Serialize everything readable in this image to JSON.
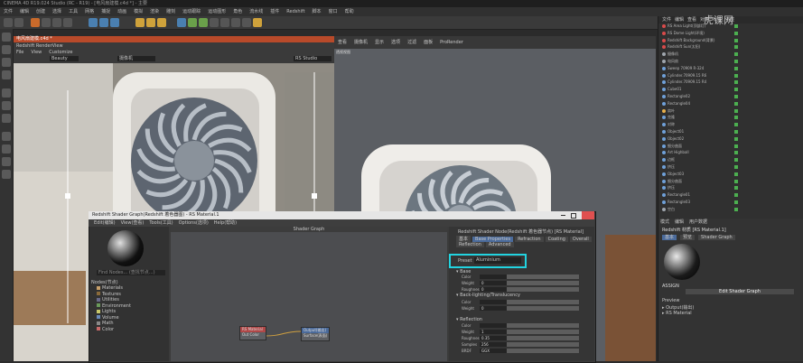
{
  "app": {
    "title": "CINEMA 4D R19.024 Studio (RC - R19) - [电风扇建模.c4d *] - 主要",
    "menu": [
      "文件",
      "编辑",
      "创建",
      "选择",
      "工具",
      "网格",
      "捕捉",
      "动画",
      "模拟",
      "渲染",
      "雕刻",
      "运动跟踪",
      "运动图形",
      "角色",
      "流水线",
      "插件",
      "Redshift",
      "脚本",
      "窗口",
      "帮助"
    ]
  },
  "watermark": "虎课网",
  "left_viewport": {
    "tabs": [
      "File",
      "View",
      "Customize"
    ],
    "title_tab": "电风扇建模.c4d *",
    "panel_title": "Redshift RenderView",
    "beauty_label": "Beauty",
    "toolbar_label": "摄像机",
    "aov_label": "RS Studio"
  },
  "right_viewport": {
    "menu": [
      "查看",
      "摄像机",
      "显示",
      "选项",
      "过滤",
      "面板",
      "ProRender"
    ],
    "label": "透视视图"
  },
  "scene_tree": {
    "header": [
      "文件",
      "编辑",
      "查看",
      "对象",
      "标签",
      "书签"
    ],
    "items": [
      {
        "label": "RS Area Light(顶部灯)",
        "color": "#d94a4a"
      },
      {
        "label": "RS Dome Light(环境)",
        "color": "#d94a4a"
      },
      {
        "label": "Redshift Background(背景)",
        "color": "#d94a4a"
      },
      {
        "label": "Redshift Sun(太阳)",
        "color": "#d94a4a"
      },
      {
        "label": "摄像机",
        "color": "#9fa6ad"
      },
      {
        "label": "电风扇",
        "color": "#9fa6ad"
      },
      {
        "label": "Sweep 70909 R-324",
        "color": "#6fa0d8"
      },
      {
        "label": "Cylinder.70909.15 R6",
        "color": "#6fa0d8"
      },
      {
        "label": "Cylinder.70909.15 R4",
        "color": "#6fa0d8"
      },
      {
        "label": "Cube01",
        "color": "#6fa0d8"
      },
      {
        "label": "Rectangle02",
        "color": "#6fa0d8"
      },
      {
        "label": "Rectangle04",
        "color": "#6fa0d8"
      },
      {
        "label": "扇叶",
        "color": "#e8b04a"
      },
      {
        "label": "克隆",
        "color": "#6fa0d8"
      },
      {
        "label": "对称",
        "color": "#6fa0d8"
      },
      {
        "label": "Object01",
        "color": "#6fa0d8"
      },
      {
        "label": "Object02",
        "color": "#6fa0d8"
      },
      {
        "label": "细分曲面",
        "color": "#6fa0d8"
      },
      {
        "label": "Art Highball",
        "color": "#6fa0d8"
      },
      {
        "label": "边框",
        "color": "#6fa0d8"
      },
      {
        "label": "挤压",
        "color": "#6fa0d8"
      },
      {
        "label": "Object03",
        "color": "#6fa0d8"
      },
      {
        "label": "细分曲面",
        "color": "#6fa0d8"
      },
      {
        "label": "挤压",
        "color": "#6fa0d8"
      },
      {
        "label": "Rectangle01",
        "color": "#6fa0d8"
      },
      {
        "label": "Rectangle03",
        "color": "#6fa0d8"
      },
      {
        "label": "空白",
        "color": "#9fa6ad"
      }
    ]
  },
  "attributes": {
    "tabs": [
      "模式",
      "编辑",
      "用户数据"
    ],
    "title": "Redshift 材质 [RS Material.1]",
    "sub_tabs": [
      "基本",
      "预览",
      "Shader Graph"
    ],
    "assign_label": "ASSIGN",
    "edit_button": "Edit Shader Graph",
    "preview_label": "Preview",
    "output": "▸ Output(输出)",
    "rs_material": "▸ RS Material"
  },
  "shader_window": {
    "title": "Redshift Shader Graph(Redshift 着色器图) - RS Material.1",
    "menu": [
      "Edit(编辑)",
      "View(查看)",
      "Tools(工具)",
      "Options(选项)",
      "Help(帮助)"
    ],
    "graph_title": "Shader Graph",
    "find_placeholder": "Find Nodes... (查找节点...)",
    "nodes_label": "Nodes(节点)",
    "categories": [
      {
        "label": "Materials",
        "color": "#c8a06a"
      },
      {
        "label": "Textures",
        "color": "#8a6a3a"
      },
      {
        "label": "Utilities",
        "color": "#6a6a8a"
      },
      {
        "label": "Environment",
        "color": "#6a9a5a"
      },
      {
        "label": "Lights",
        "color": "#c8c86a"
      },
      {
        "label": "Volume",
        "color": "#6a8aba"
      },
      {
        "label": "Math",
        "color": "#8a8a8a"
      },
      {
        "label": "Color",
        "color": "#c86a6a"
      }
    ],
    "node_material": {
      "title": "RS Material",
      "port": "Out Color"
    },
    "node_output": {
      "title": "Output(输出)",
      "port": "Surface(表面)"
    },
    "props_title": "Redshift Shader Node(Redshift 着色器节点) [RS Material]",
    "props_tabs": [
      "基本",
      "Base Properties",
      "Refraction",
      "Coating",
      "Overall"
    ],
    "props_tabs2": [
      "Reflection",
      "Advanced"
    ],
    "preset_label": "Preset",
    "preset_value": "Aluminium",
    "section_base": "▾ Base",
    "section_bl": "▾ Back-lighting/Translucency",
    "section_refl": "▾ Reflection",
    "rows": [
      {
        "k": "Color",
        "v": ""
      },
      {
        "k": "Weight",
        "v": "0"
      },
      {
        "k": "Roughness",
        "v": "0"
      },
      {
        "k": "Color",
        "v": ""
      },
      {
        "k": "Weight",
        "v": "0"
      },
      {
        "k": "Color",
        "v": ""
      },
      {
        "k": "Weight",
        "v": "1"
      },
      {
        "k": "Roughness",
        "v": "0.35"
      },
      {
        "k": "Samples",
        "v": "256"
      },
      {
        "k": "BRDF",
        "v": "GGX"
      }
    ]
  }
}
